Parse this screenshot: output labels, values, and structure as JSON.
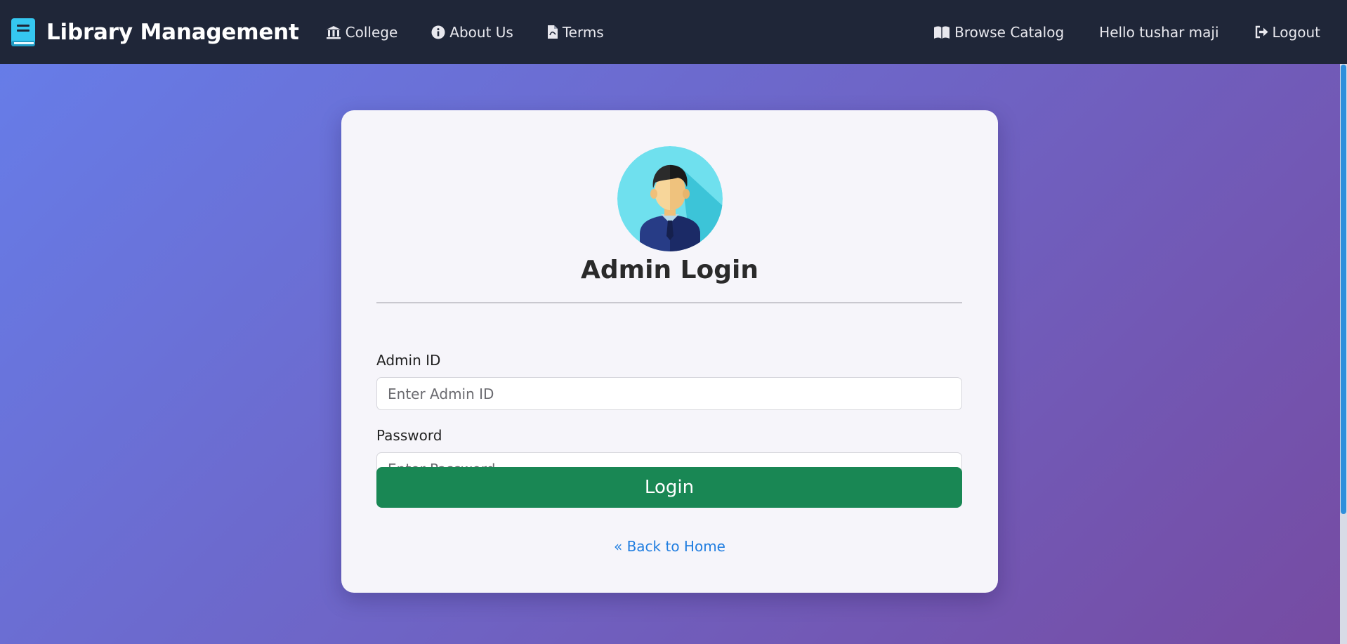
{
  "navbar": {
    "brand": "Library Management",
    "brand_icon": "book-icon",
    "links_left": [
      {
        "label": "College",
        "icon": "institution-icon"
      },
      {
        "label": "About Us",
        "icon": "info-circle-icon"
      },
      {
        "label": "Terms",
        "icon": "file-pdf-icon"
      }
    ],
    "links_right": [
      {
        "label": "Browse Catalog",
        "icon": "open-book-icon"
      },
      {
        "label": "Hello tushar maji"
      },
      {
        "label": "Logout",
        "icon": "sign-out-icon"
      }
    ]
  },
  "login": {
    "title": "Admin Login",
    "avatar_icon": "admin-avatar-icon",
    "admin_id_label": "Admin ID",
    "admin_id_placeholder": "Enter Admin ID",
    "admin_id_value": "",
    "password_label": "Password",
    "password_placeholder": "Enter Password",
    "password_value": "",
    "submit_label": "Login",
    "back_link": "« Back to Home"
  },
  "colors": {
    "navbar_bg": "#1f2638",
    "gradient_start": "#667eea",
    "gradient_end": "#764ba2",
    "login_button": "#198754",
    "link": "#1f7de0"
  }
}
